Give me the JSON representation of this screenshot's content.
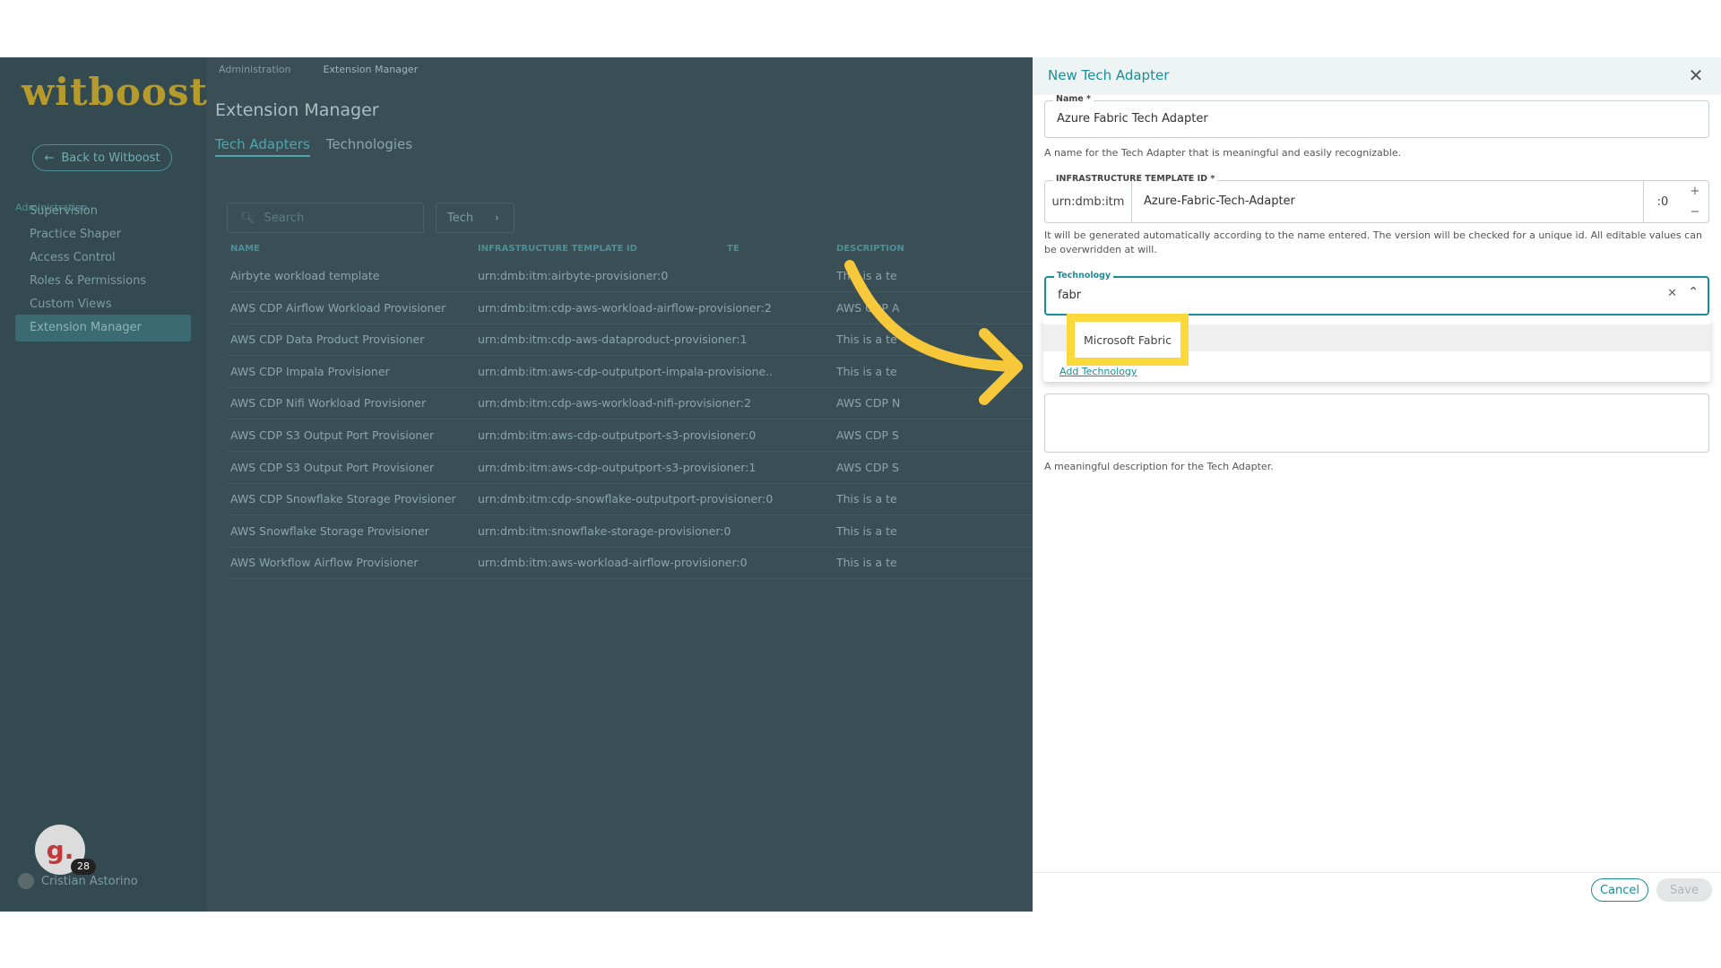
{
  "app": {
    "logo_text": "witboost",
    "back_button": "Back to Witboost",
    "sidebar_section": "Administration",
    "sidebar_items": [
      "Supervision",
      "Practice Shaper",
      "Access Control",
      "Roles & Permissions",
      "Custom Views",
      "Extension Manager"
    ],
    "active_sidebar_item": "Extension Manager",
    "user_name": "Cristian Astorino",
    "badge_letter": "g.",
    "badge_count": "28"
  },
  "main": {
    "breadcrumb": [
      "Administration",
      "Extension Manager"
    ],
    "title": "Extension Manager",
    "tabs": [
      "Tech Adapters",
      "Technologies"
    ],
    "active_tab": "Tech Adapters",
    "search_placeholder": "Search",
    "filter_label": "Tech",
    "columns": [
      "NAME",
      "INFRASTRUCTURE TEMPLATE ID",
      "TE",
      "DESCRIPTION"
    ],
    "rows": [
      {
        "name": "Airbyte workload template",
        "id": "urn:dmb:itm:airbyte-provisioner:0",
        "desc": "This is a te"
      },
      {
        "name": "AWS CDP Airflow Workload Provisioner",
        "id": "urn:dmb:itm:cdp-aws-workload-airflow-provisioner:2",
        "desc": "AWS CDP A"
      },
      {
        "name": "AWS CDP Data Product Provisioner",
        "id": "urn:dmb:itm:cdp-aws-dataproduct-provisioner:1",
        "desc": "This is a te"
      },
      {
        "name": "AWS CDP Impala Provisioner",
        "id": "urn:dmb:itm:aws-cdp-outputport-impala-provisione...",
        "desc": "This is a te"
      },
      {
        "name": "AWS CDP Nifi Workload Provisioner",
        "id": "urn:dmb:itm:cdp-aws-workload-nifi-provisioner:2",
        "desc": "AWS CDP N"
      },
      {
        "name": "AWS CDP S3 Output Port Provisioner",
        "id": "urn:dmb:itm:aws-cdp-outputport-s3-provisioner:0",
        "desc": "AWS CDP S"
      },
      {
        "name": "AWS CDP S3 Output Port Provisioner",
        "id": "urn:dmb:itm:aws-cdp-outputport-s3-provisioner:1",
        "desc": "AWS CDP S"
      },
      {
        "name": "AWS CDP Snowflake Storage Provisioner",
        "id": "urn:dmb:itm:cdp-snowflake-outputport-provisioner:0",
        "desc": "This is a te"
      },
      {
        "name": "AWS Snowflake Storage Provisioner",
        "id": "urn:dmb:itm:snowflake-storage-provisioner:0",
        "desc": "This is a te"
      },
      {
        "name": "AWS Workflow Airflow Provisioner",
        "id": "urn:dmb:itm:aws-workload-airflow-provisioner:0",
        "desc": "This is a te"
      }
    ]
  },
  "drawer": {
    "title": "New Tech Adapter",
    "name_label": "Name *",
    "name_value": "Azure Fabric Tech Adapter",
    "name_helper": "A name for the Tech Adapter that is meaningful and easily recognizable.",
    "infra_label": "INFRASTRUCTURE TEMPLATE ID *",
    "infra_prefix": "urn:dmb:itm",
    "infra_value": "Azure-Fabric-Tech-Adapter",
    "infra_version": ":0",
    "infra_helper": "It will be generated automatically according to the name entered. The version will be checked for a unique id. All editable values can be overwridden at will.",
    "tech_label": "Technology",
    "tech_value": "fabr",
    "dropdown_option": "Microsoft Fabric",
    "add_technology": "Add Technology",
    "desc_helper": "A meaningful description for the Tech Adapter.",
    "cancel": "Cancel",
    "save": "Save"
  },
  "colors": {
    "accent": "#1a8e98",
    "highlight": "#fcd93a",
    "arrow": "#f7c93a",
    "overlay": "#3a4f55"
  }
}
